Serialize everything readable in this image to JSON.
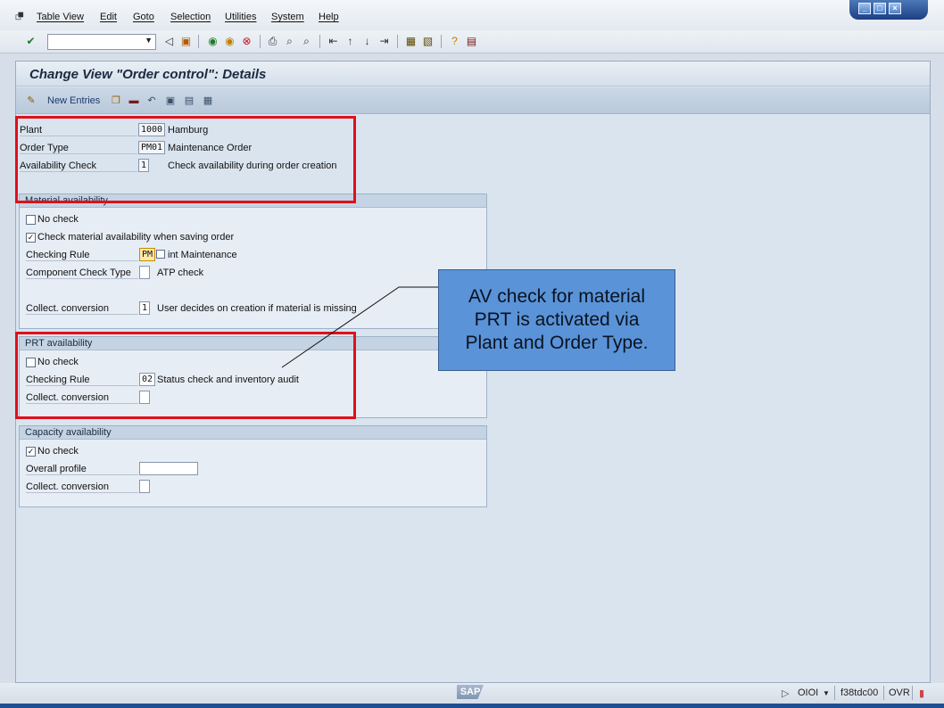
{
  "menu": {
    "items": [
      "Table View",
      "Edit",
      "Goto",
      "Selection",
      "Utilities",
      "System",
      "Help"
    ]
  },
  "window_buttons": [
    "minimize-icon",
    "maximize-icon",
    "close-icon"
  ],
  "toolbar": {
    "command_field": "",
    "icons": [
      "enter-icon",
      "back-icon",
      "save-icon",
      "back-green-icon",
      "exit-icon",
      "cancel-icon",
      "print-icon",
      "find-icon",
      "find-next-icon",
      "first-page-icon",
      "previous-page-icon",
      "next-page-icon",
      "last-page-icon",
      "create-session-icon",
      "shortcut-icon",
      "help-icon",
      "layout-menu-icon"
    ]
  },
  "screen": {
    "title": "Change View \"Order control\": Details",
    "app_toolbar": {
      "new_entries": "New Entries"
    }
  },
  "header_fields": {
    "plant": {
      "label": "Plant",
      "value": "1000",
      "text": "Hamburg"
    },
    "order_type": {
      "label": "Order Type",
      "value": "PM01",
      "text": "Maintenance Order"
    },
    "availability_check": {
      "label": "Availability Check",
      "value": "1",
      "text": "Check availability during order creation"
    }
  },
  "material_availability": {
    "title": "Material availability",
    "no_check": {
      "label": "No check",
      "checked": false
    },
    "check_on_save": {
      "label": "Check material availability when saving order",
      "checked": true
    },
    "checking_rule": {
      "label": "Checking Rule",
      "value": "PM",
      "text": "int Maintenance"
    },
    "component_check_type": {
      "label": "Component Check Type",
      "value": "",
      "text": "ATP check"
    },
    "collect_conversion": {
      "label": "Collect. conversion",
      "value": "1",
      "text": "User decides on creation if material is missing"
    }
  },
  "prt_availability": {
    "title": "PRT availability",
    "no_check": {
      "label": "No check",
      "checked": false
    },
    "checking_rule": {
      "label": "Checking Rule",
      "value": "02",
      "text": "Status check and inventory audit"
    },
    "collect_conversion": {
      "label": "Collect. conversion",
      "value": ""
    }
  },
  "capacity_availability": {
    "title": "Capacity availability",
    "no_check": {
      "label": "No check",
      "checked": true
    },
    "overall_profile": {
      "label": "Overall profile",
      "value": ""
    },
    "collect_conversion": {
      "label": "Collect. conversion",
      "value": ""
    }
  },
  "callout": {
    "line1": "AV check for material",
    "line2": "PRT is activated via",
    "line3": "Plant and Order Type."
  },
  "status_bar": {
    "logo": "SAP",
    "client": "OIOI",
    "server": "f38tdc00",
    "mode": "OVR"
  },
  "colors": {
    "highlight_box": "#e0101a",
    "callout_fill": "#5a93d8",
    "focus_field": "#ffe9a8"
  }
}
